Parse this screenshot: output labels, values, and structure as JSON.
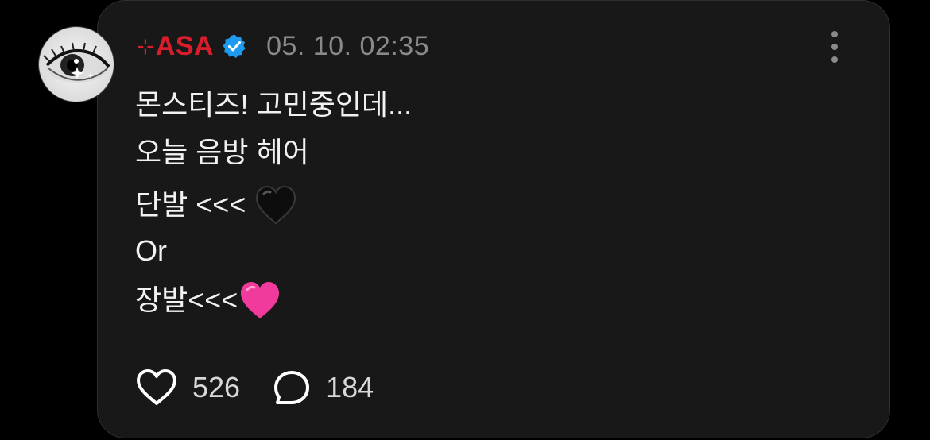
{
  "post": {
    "author": {
      "prefix_symbol": "⊹",
      "name": "ASA",
      "verified": true
    },
    "timestamp": "05. 10. 02:35",
    "lines": [
      "몬스티즈! 고민중인데...",
      "오늘 음방 헤어",
      "단발 <<< ",
      "Or",
      "장발<<<"
    ],
    "likes": "526",
    "replies": "184"
  },
  "icons": {
    "avatar": "eye-closeup-avatar",
    "verified": "verified-badge-icon",
    "black_heart": "black-heart-emoji",
    "pink_heart": "pink-heart-emoji",
    "like": "heart-outline-icon",
    "reply": "speech-bubble-icon",
    "more": "more-vertical-icon"
  },
  "colors": {
    "username": "#d81e2c",
    "verified": "#1d9bf0",
    "timestamp": "#8a8a8a",
    "text": "#f2f2f2",
    "card": "#181818",
    "pink_heart": "#f03b9c"
  }
}
